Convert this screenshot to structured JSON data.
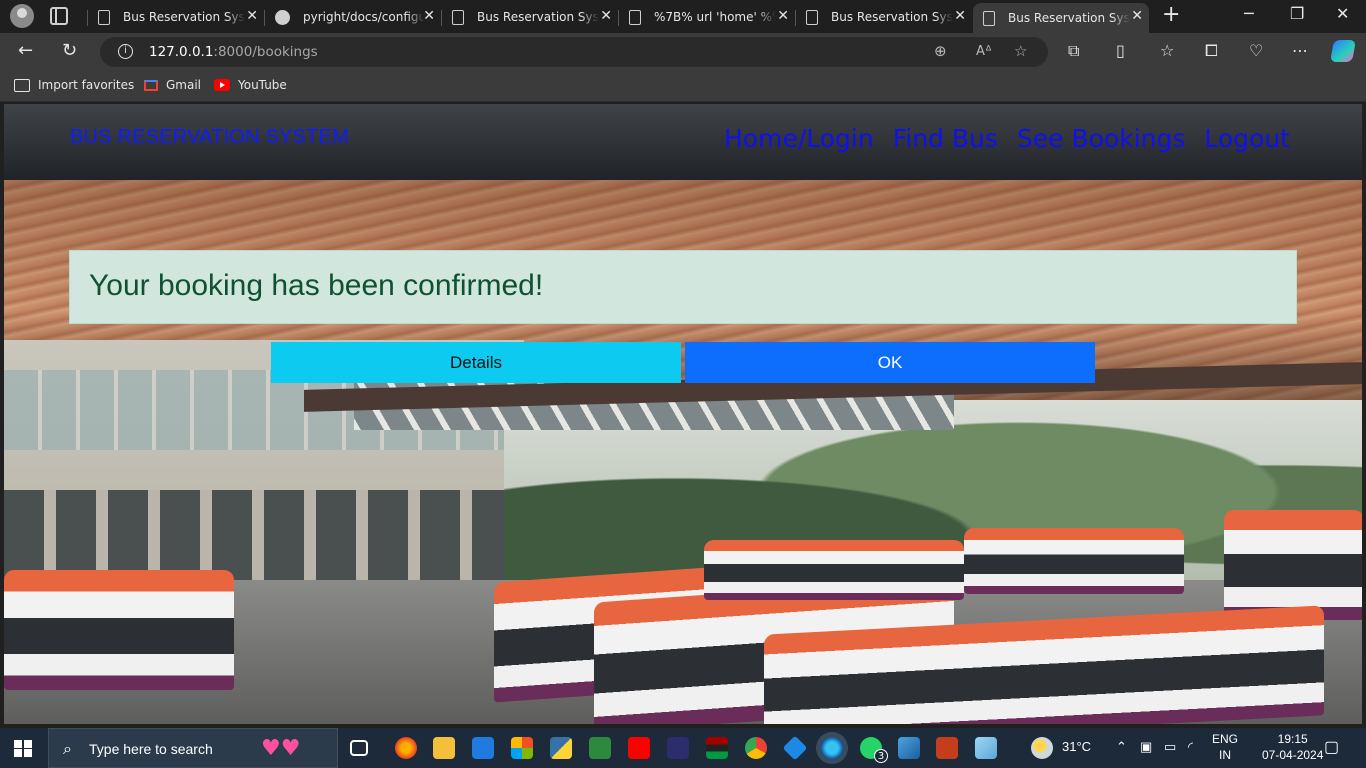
{
  "browser": {
    "tabs": [
      {
        "title": "Bus Reservation System",
        "icon": "page-icon",
        "active": false
      },
      {
        "title": "pyright/docs/configuration",
        "icon": "github-icon",
        "active": false
      },
      {
        "title": "Bus Reservation System",
        "icon": "page-icon",
        "active": false
      },
      {
        "title": "%7B% url 'home' %%",
        "icon": "page-icon",
        "active": false
      },
      {
        "title": "Bus Reservation System",
        "icon": "page-icon",
        "active": false
      },
      {
        "title": "Bus Reservation System",
        "icon": "page-icon",
        "active": true
      }
    ],
    "close_glyph": "✕",
    "new_tab_glyph": "+",
    "address": {
      "host": "127.0.0.1",
      "path": ":8000/bookings"
    },
    "bookmarks": [
      {
        "label": "Import favorites",
        "icon": "import-icon"
      },
      {
        "label": "Gmail",
        "icon": "gmail-icon"
      },
      {
        "label": "YouTube",
        "icon": "youtube-icon"
      }
    ]
  },
  "site": {
    "brand": "BUS RESERVATION SYSTEM",
    "nav": [
      "Home/Login",
      "Find Bus",
      "See Bookings",
      "Logout"
    ],
    "brand_color": "#0d1cff",
    "nav_color": "#1010ee"
  },
  "alert": {
    "message": "Your booking has been confirmed!",
    "bg": "#d1e7dd",
    "color": "#0f5132"
  },
  "buttons": {
    "details": "Details",
    "ok": "OK"
  },
  "taskbar": {
    "search_placeholder": "Type here to search",
    "weather": "31°C",
    "lang_top": "ENG",
    "lang_bottom": "IN",
    "time": "19:15",
    "date": "07-04-2024",
    "whatsapp_badge": "3"
  }
}
